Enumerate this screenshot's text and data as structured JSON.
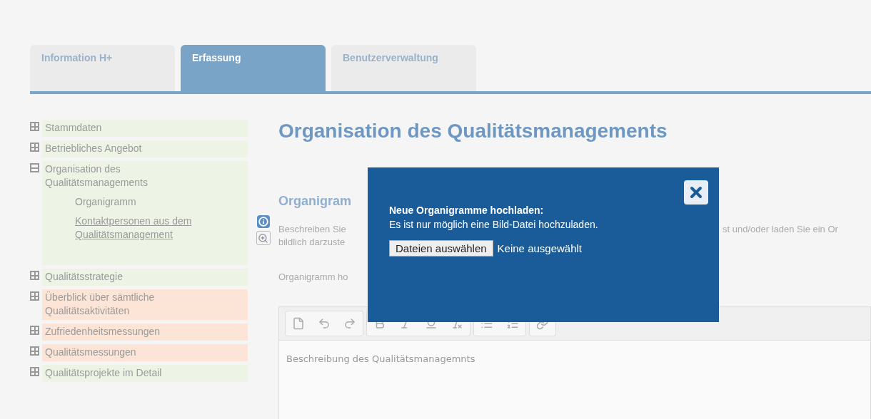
{
  "tabs": [
    {
      "label": "Information H+",
      "selected": false
    },
    {
      "label": "Erfassung",
      "selected": true
    },
    {
      "label": "Benutzerverwaltung",
      "selected": false
    }
  ],
  "sidebar": {
    "items": [
      {
        "label": "Stammdaten",
        "expanded": false,
        "color": "#edf4e6"
      },
      {
        "label": "Betriebliches Angebot",
        "expanded": false,
        "color": "#edf4e6"
      },
      {
        "label": "Organisation des Qualitätsmanagements",
        "expanded": true,
        "color": "#edf4e6",
        "children": [
          {
            "label": "Organigramm",
            "kind": "plain"
          },
          {
            "label": "Kontaktpersonen aus dem Qualitätsmanagement",
            "kind": "link"
          }
        ]
      },
      {
        "label": "Qualitätsstrategie",
        "expanded": false,
        "color": "#edf4e6"
      },
      {
        "label": "Überblick über sämtliche Qualitätsaktivitäten",
        "expanded": false,
        "color": "#fce5d6"
      },
      {
        "label": "Zufriedenheitsmessungen",
        "expanded": false,
        "color": "#fce5d6"
      },
      {
        "label": "Qualitätsmessungen",
        "expanded": false,
        "color": "#fce5d6"
      },
      {
        "label": "Qualitätsprojekte im Detail",
        "expanded": false,
        "color": "#edf4e6"
      }
    ]
  },
  "main": {
    "title": "Organisation des Qualitätsmanagements",
    "section_heading": "Organigram",
    "description": {
      "line_1_left": "Beschreiben Sie",
      "line_1_right": "st und/oder laden Sie ein Or",
      "line_2_left": "bildlich darzuste"
    },
    "upload_label": "Organigramm ho",
    "editor": {
      "placeholder": "Beschreibung des Qualitätsmanagemnts"
    }
  },
  "modal": {
    "title": "Neue Organigramme hochladen:",
    "message": "Es ist nur möglich eine Bild-Datei hochzuladen.",
    "file_button": "Dateien auswählen",
    "file_status": "Keine ausgewählt"
  }
}
